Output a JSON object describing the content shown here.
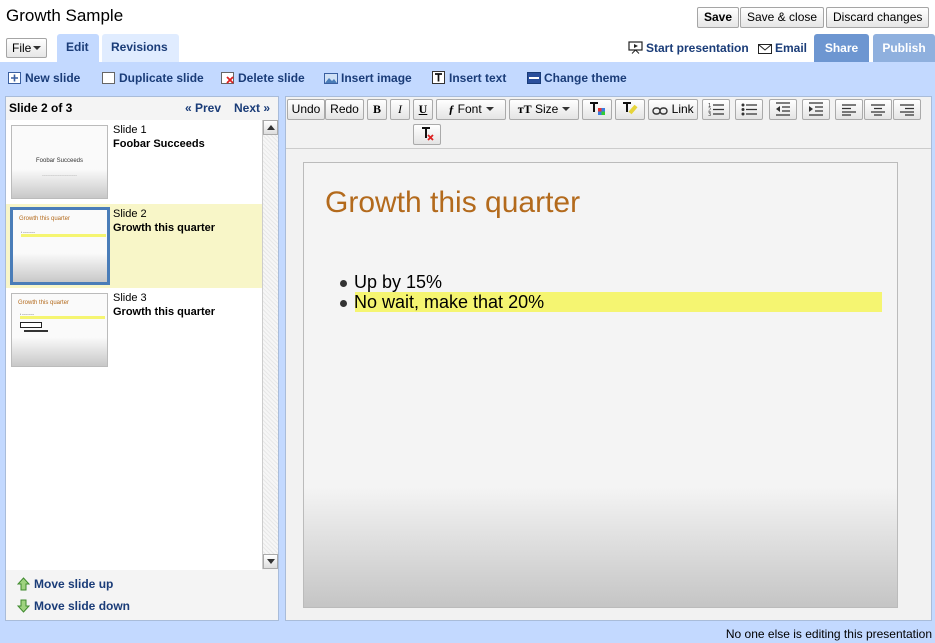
{
  "title": "Growth Sample",
  "header_buttons": {
    "save": "Save",
    "save_close": "Save & close",
    "discard": "Discard changes"
  },
  "menu": {
    "file": "File"
  },
  "tabs": {
    "edit": "Edit",
    "revisions": "Revisions"
  },
  "header_links": {
    "start_presentation": "Start presentation",
    "email": "Email",
    "share": "Share",
    "publish": "Publish"
  },
  "actions": {
    "new_slide": "New slide",
    "duplicate_slide": "Duplicate slide",
    "delete_slide": "Delete slide",
    "insert_image": "Insert image",
    "insert_text": "Insert text",
    "change_theme": "Change theme"
  },
  "slide_nav": {
    "count": "Slide 2 of 3",
    "prev": "« Prev",
    "next": "Next »"
  },
  "slides": [
    {
      "num": "Slide 1",
      "name": "Foobar Succeeds",
      "thumb_text": "Foobar Succeeds"
    },
    {
      "num": "Slide 2",
      "name": "Growth this quarter",
      "thumb_title": "Growth this quarter"
    },
    {
      "num": "Slide 3",
      "name": "Growth this quarter",
      "thumb_title": "Growth this quarter"
    }
  ],
  "move": {
    "up": "Move slide up",
    "down": "Move slide down"
  },
  "toolbar": {
    "undo": "Undo",
    "redo": "Redo",
    "bold": "B",
    "italic": "I",
    "underline": "U",
    "font": "Font",
    "size": "Size",
    "link": "Link"
  },
  "current_slide": {
    "title": "Growth this quarter",
    "bullets": [
      "Up by 15%",
      "No wait, make that 20%"
    ]
  },
  "colors": {
    "accent_blue": "#c3d9ff",
    "link_blue": "#1a3c78",
    "title_orange": "#b36a1c",
    "highlight_yellow": "#f5f571"
  },
  "status": "No one else is editing this presentation"
}
